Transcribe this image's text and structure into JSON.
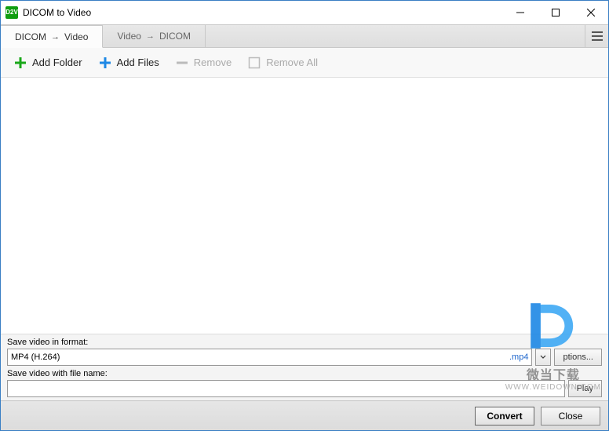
{
  "titlebar": {
    "title": "DICOM to Video"
  },
  "tabs": [
    {
      "label_a": "DICOM",
      "label_b": "Video"
    },
    {
      "label_a": "Video",
      "label_b": "DICOM"
    }
  ],
  "toolbar": {
    "add_folder": "Add Folder",
    "add_files": "Add Files",
    "remove": "Remove",
    "remove_all": "Remove All"
  },
  "format": {
    "label": "Save video in format:",
    "value": "MP4 (H.264)",
    "ext": ".mp4",
    "options_btn": "ptions..."
  },
  "filename": {
    "label": "Save video with file name:",
    "value": "",
    "play_btn": "Play"
  },
  "footer": {
    "convert": "Convert",
    "close": "Close"
  },
  "watermark": {
    "text": "微当下载",
    "url": "WWW.WEIDOWN.COM"
  }
}
